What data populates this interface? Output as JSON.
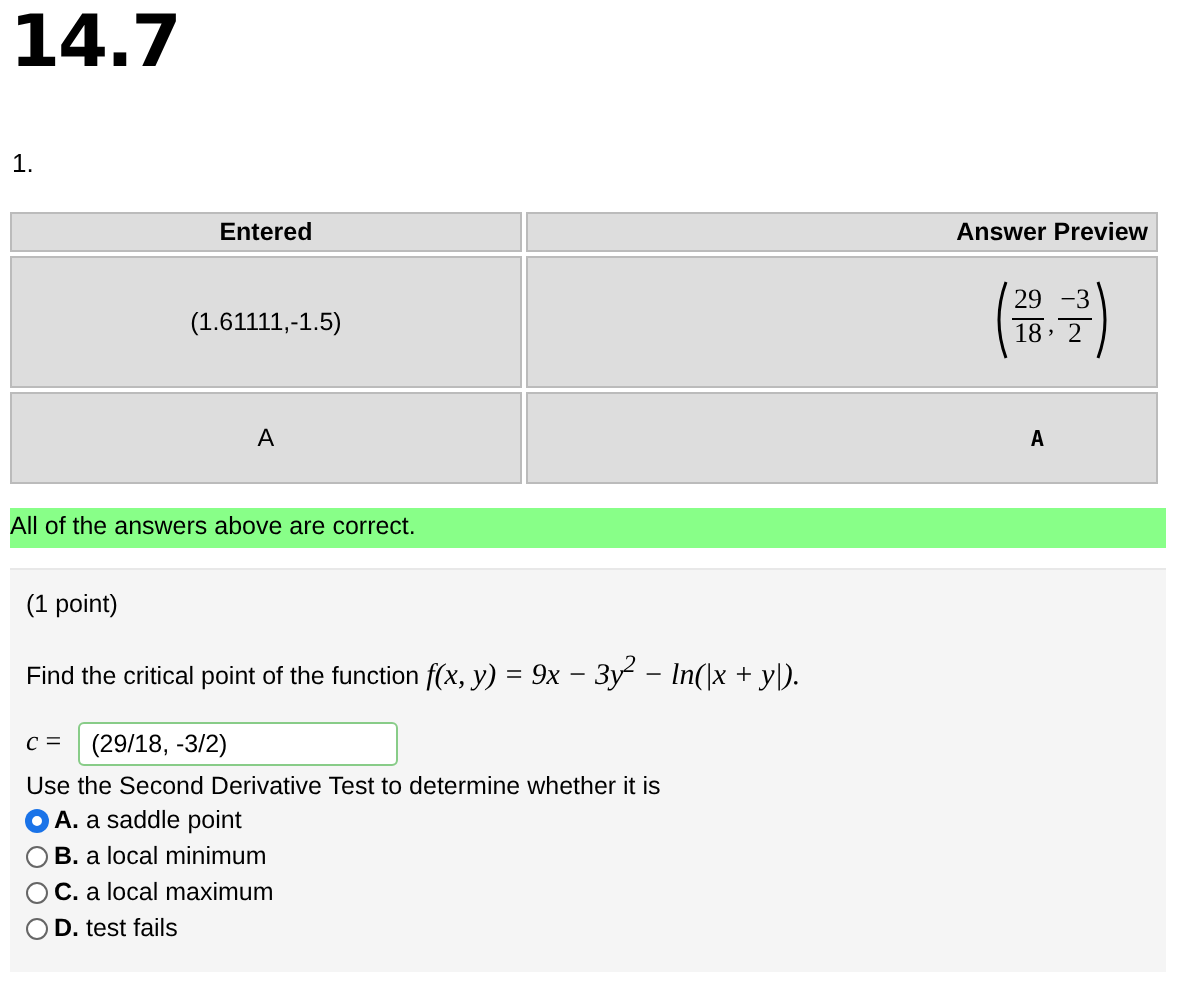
{
  "title": "14.7",
  "problem_number": "1.",
  "results_table": {
    "columns": [
      "Entered",
      "Answer Preview"
    ],
    "rows": [
      {
        "entered": "(1.61111,-1.5)",
        "preview": {
          "kind": "fractions",
          "fractions": [
            {
              "num": "29",
              "den": "18"
            },
            {
              "num": "−3",
              "den": "2"
            }
          ],
          "separator": ","
        }
      },
      {
        "entered": "A",
        "preview": {
          "kind": "letter",
          "text": "A"
        }
      }
    ]
  },
  "feedback": "All of the answers above are correct.",
  "problem": {
    "points": "(1 point)",
    "prompt": "Find the critical point of the function",
    "formula": "f(x, y) = 9x − 3y$^{2}$ − ln(|x + y|).",
    "answer_label": "*c* =",
    "answer_value": "(29/18, -3/2)",
    "instruction": "Use the Second Derivative Test to determine whether it is",
    "choices": [
      {
        "label": "**A.** a saddle point",
        "selected": true
      },
      {
        "label": "**B.** a local minimum",
        "selected": false
      },
      {
        "label": "**C.** a local maximum",
        "selected": false
      },
      {
        "label": "**D.** test fails",
        "selected": false
      }
    ]
  }
}
